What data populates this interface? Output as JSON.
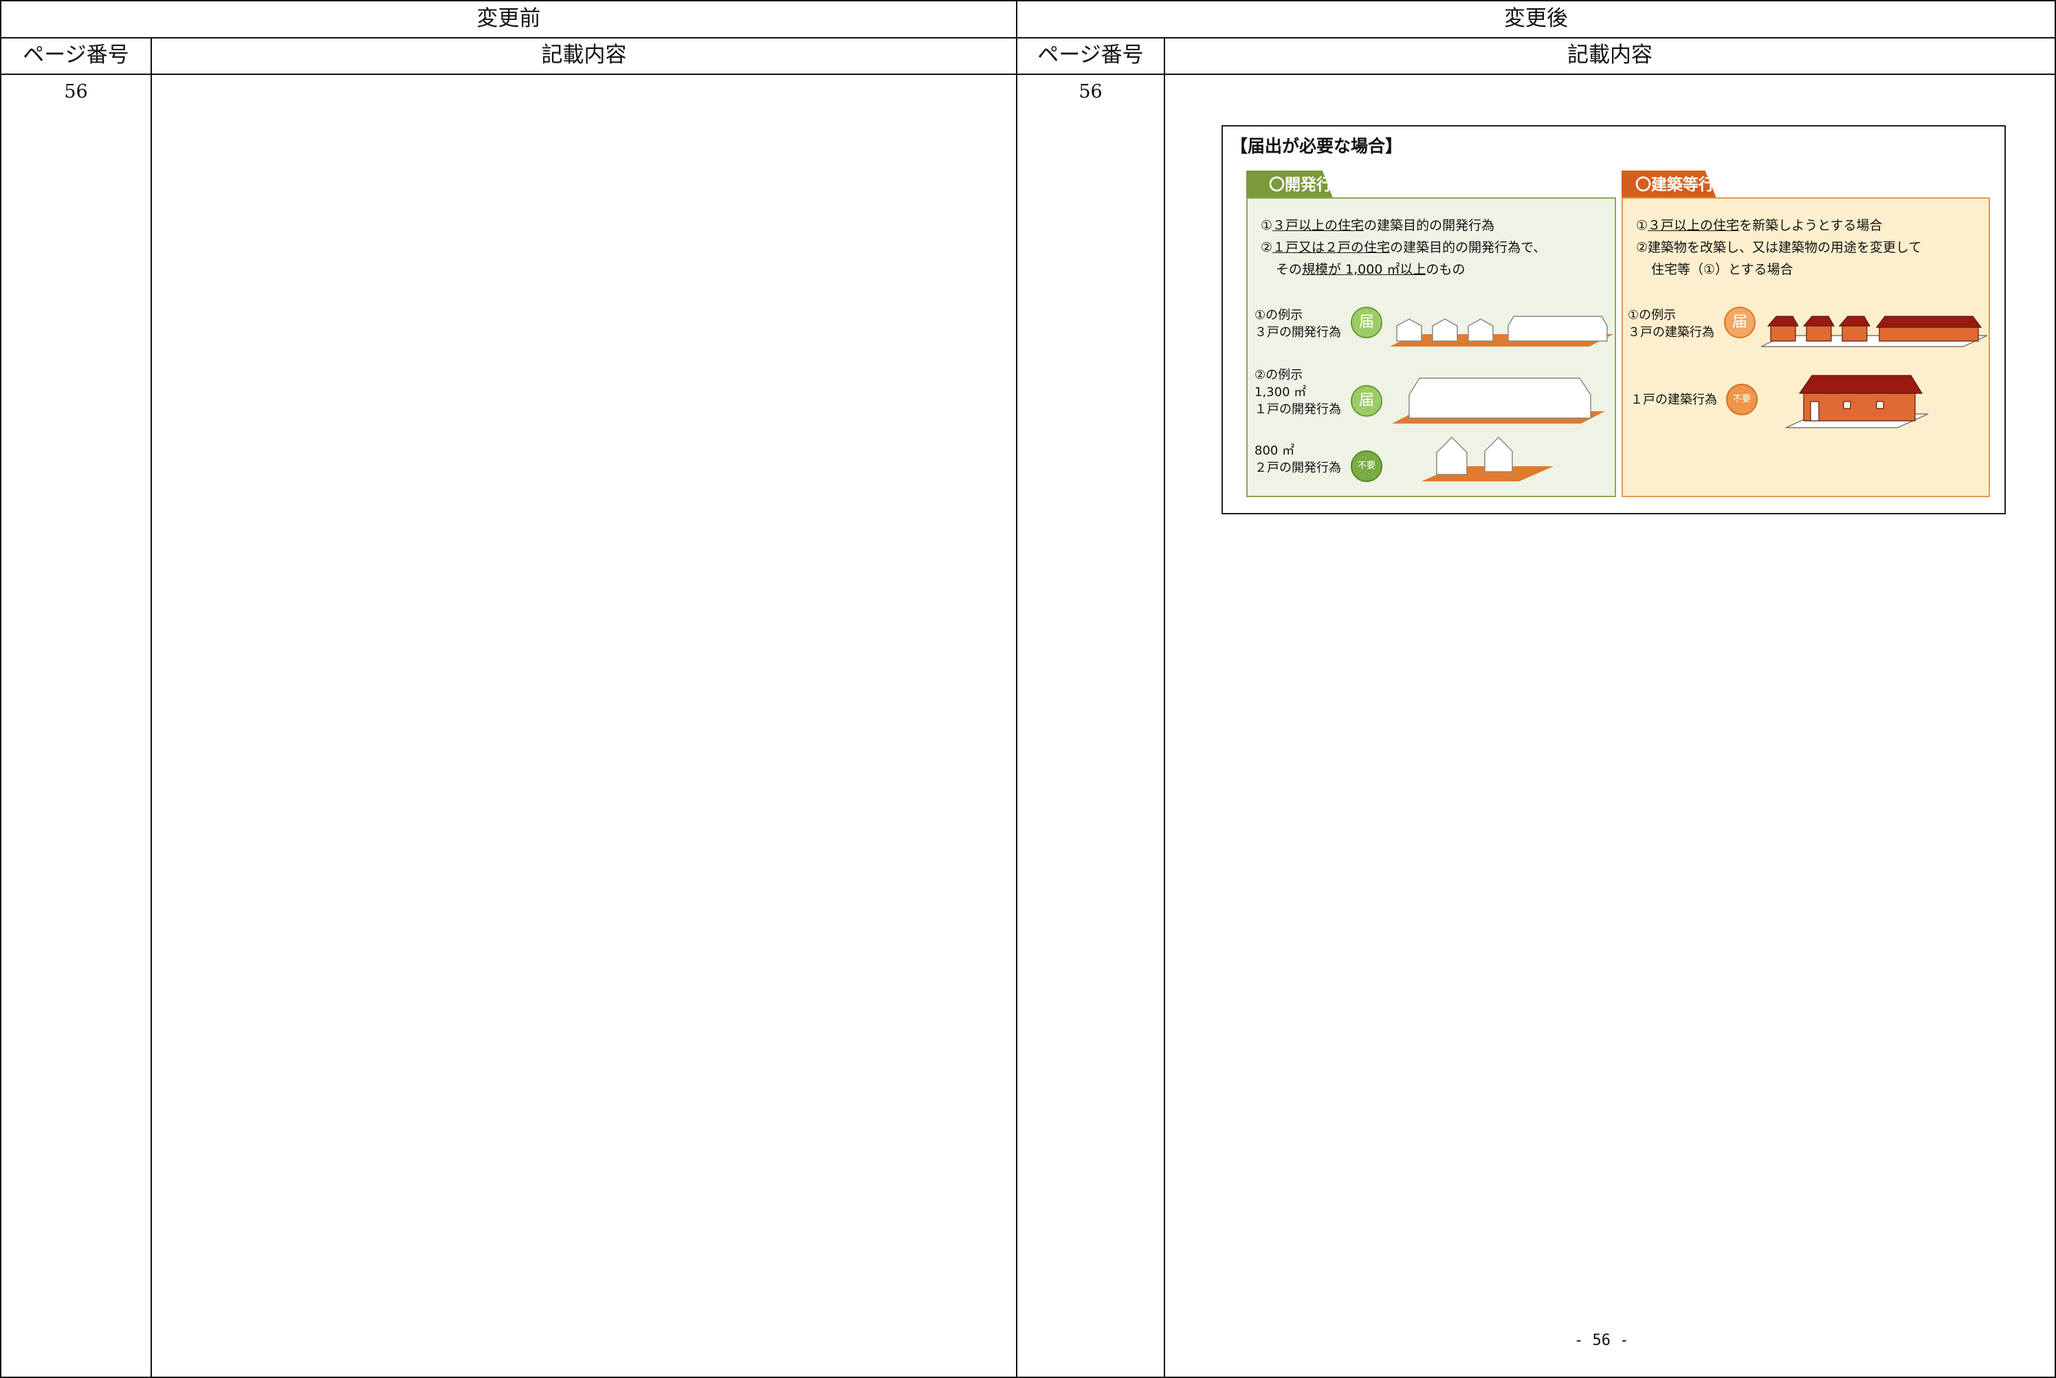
{
  "table": {
    "before_header": "変更前",
    "after_header": "変更後",
    "col_page": "ページ番号",
    "col_content": "記載内容",
    "before_page": "56",
    "after_page": "56"
  },
  "figure": {
    "title": "【届出が必要な場合】",
    "left": {
      "tab": "〇開発行為",
      "tab_color": "#7a9a3c",
      "bg_color": "#eef3e6",
      "line1": {
        "pre": "①",
        "u": "３戸以上の住宅",
        "post": "の建築目的の開発行為"
      },
      "line2": {
        "pre": "②",
        "u1": "１戸又は２戸の住宅",
        "mid": "の建築目的の開発行為で、"
      },
      "line3": {
        "pre": "その",
        "u": "規模が 1,000 ㎡以上",
        "post": "のもの"
      },
      "ex1": {
        "l1": "①の例示",
        "l2": "３戸の開発行為",
        "badge": "届"
      },
      "ex2": {
        "l1": "②の例示",
        "l2": "1,300 ㎡",
        "l3": "１戸の開発行為",
        "badge": "届"
      },
      "ex3": {
        "l1": "800 ㎡",
        "l2": "２戸の開発行為",
        "badge": "不要"
      }
    },
    "right": {
      "tab": "〇建築等行為",
      "tab_color": "#d35f1c",
      "bg_color": "#fdefcd",
      "line1": {
        "pre": "①",
        "u": "３戸以上の住宅",
        "post": "を新築しようとする場合"
      },
      "line2": "②建築物を改築し、又は建築物の用途を変更して",
      "line3": "住宅等（①）とする場合",
      "ex1": {
        "l1": "①の例示",
        "l2": "３戸の建築行為",
        "badge": "届"
      },
      "ex2": {
        "l1": "１戸の建築行為",
        "badge": "不要"
      }
    }
  },
  "footer": "- 56 -"
}
